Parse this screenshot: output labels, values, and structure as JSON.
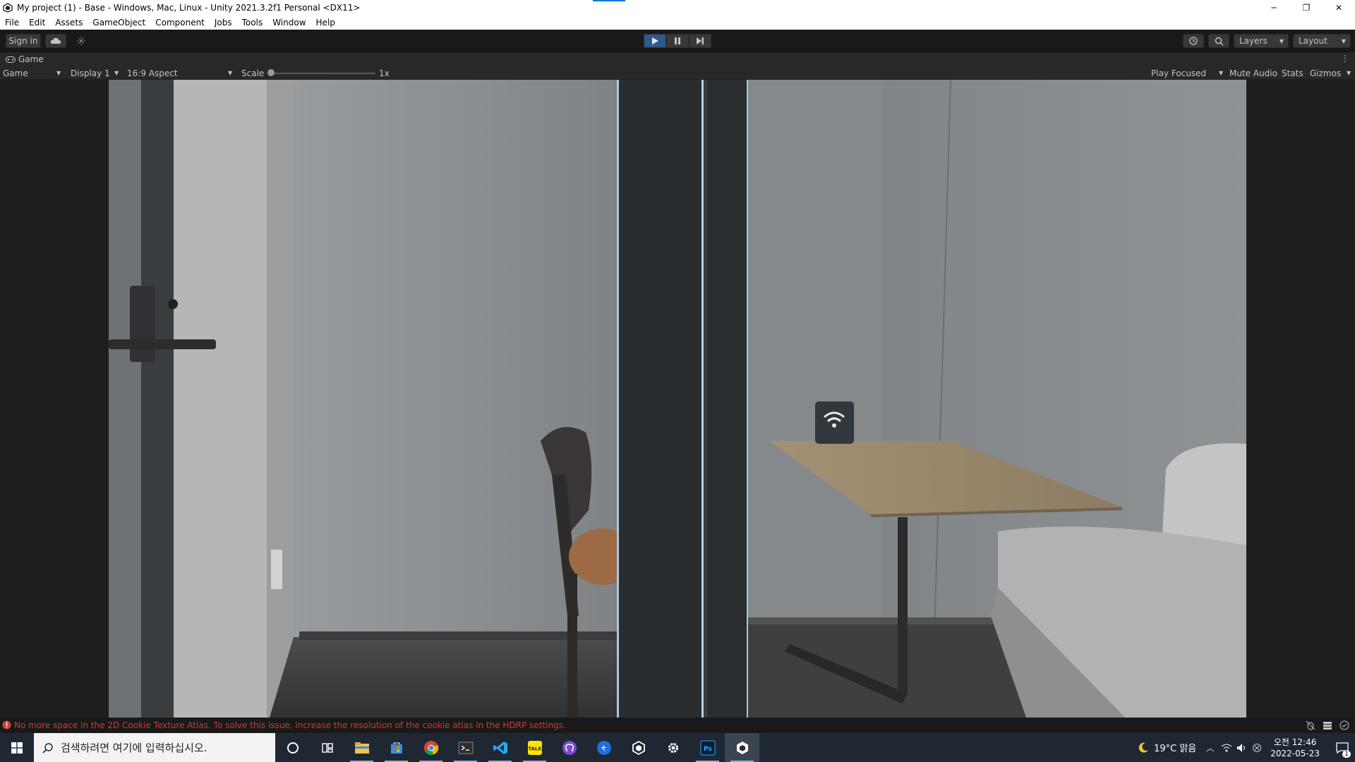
{
  "window": {
    "title": "My project (1) - Base - Windows, Mac, Linux - Unity 2021.3.2f1 Personal <DX11>",
    "controls": [
      "─",
      "❐",
      "✕"
    ]
  },
  "menu": [
    "File",
    "Edit",
    "Assets",
    "GameObject",
    "Component",
    "Jobs",
    "Tools",
    "Window",
    "Help"
  ],
  "toolbar": {
    "sign_in": "Sign in",
    "layers": "Layers",
    "layout": "Layout",
    "play_active": true
  },
  "tab": {
    "label": "Game",
    "more": "⋮"
  },
  "game_bar": {
    "mode": "Game",
    "display": "Display 1",
    "aspect": "16:9 Aspect",
    "scale_label": "Scale",
    "scale_value": "1x",
    "scale_fraction": 0.0,
    "play_focused": "Play Focused",
    "mute_audio": "Mute Audio",
    "stats": "Stats",
    "gizmos": "Gizmos"
  },
  "status": {
    "error": "No more space in the 2D Cookie Texture Atlas. To solve this issue, increase the resolution of the cookie atlas in the HDRP settings."
  },
  "taskbar": {
    "search_placeholder": "검색하려면 여기에 입력하십시오.",
    "weather": "19°C 맑음",
    "time": "오전 12:46",
    "date": "2022-05-23",
    "notification_count": "1",
    "apps": [
      "cortana-icon",
      "task-view-icon",
      "file-explorer-icon",
      "store-icon",
      "chrome-icon",
      "terminal-icon",
      "vscode-icon",
      "kakaotalk-icon",
      "github-desktop-icon",
      "sourcetree-icon",
      "unity-hub-icon",
      "settings-icon",
      "photoshop-icon",
      "unity-editor-icon"
    ],
    "kakaotalk_label": "TALK",
    "photoshop_label": "Ps"
  },
  "colors": {
    "accent": "#0078d7",
    "error": "#c93b3b",
    "editor_dark": "#191919",
    "panel": "#282828",
    "taskbar": "#1f2733"
  }
}
